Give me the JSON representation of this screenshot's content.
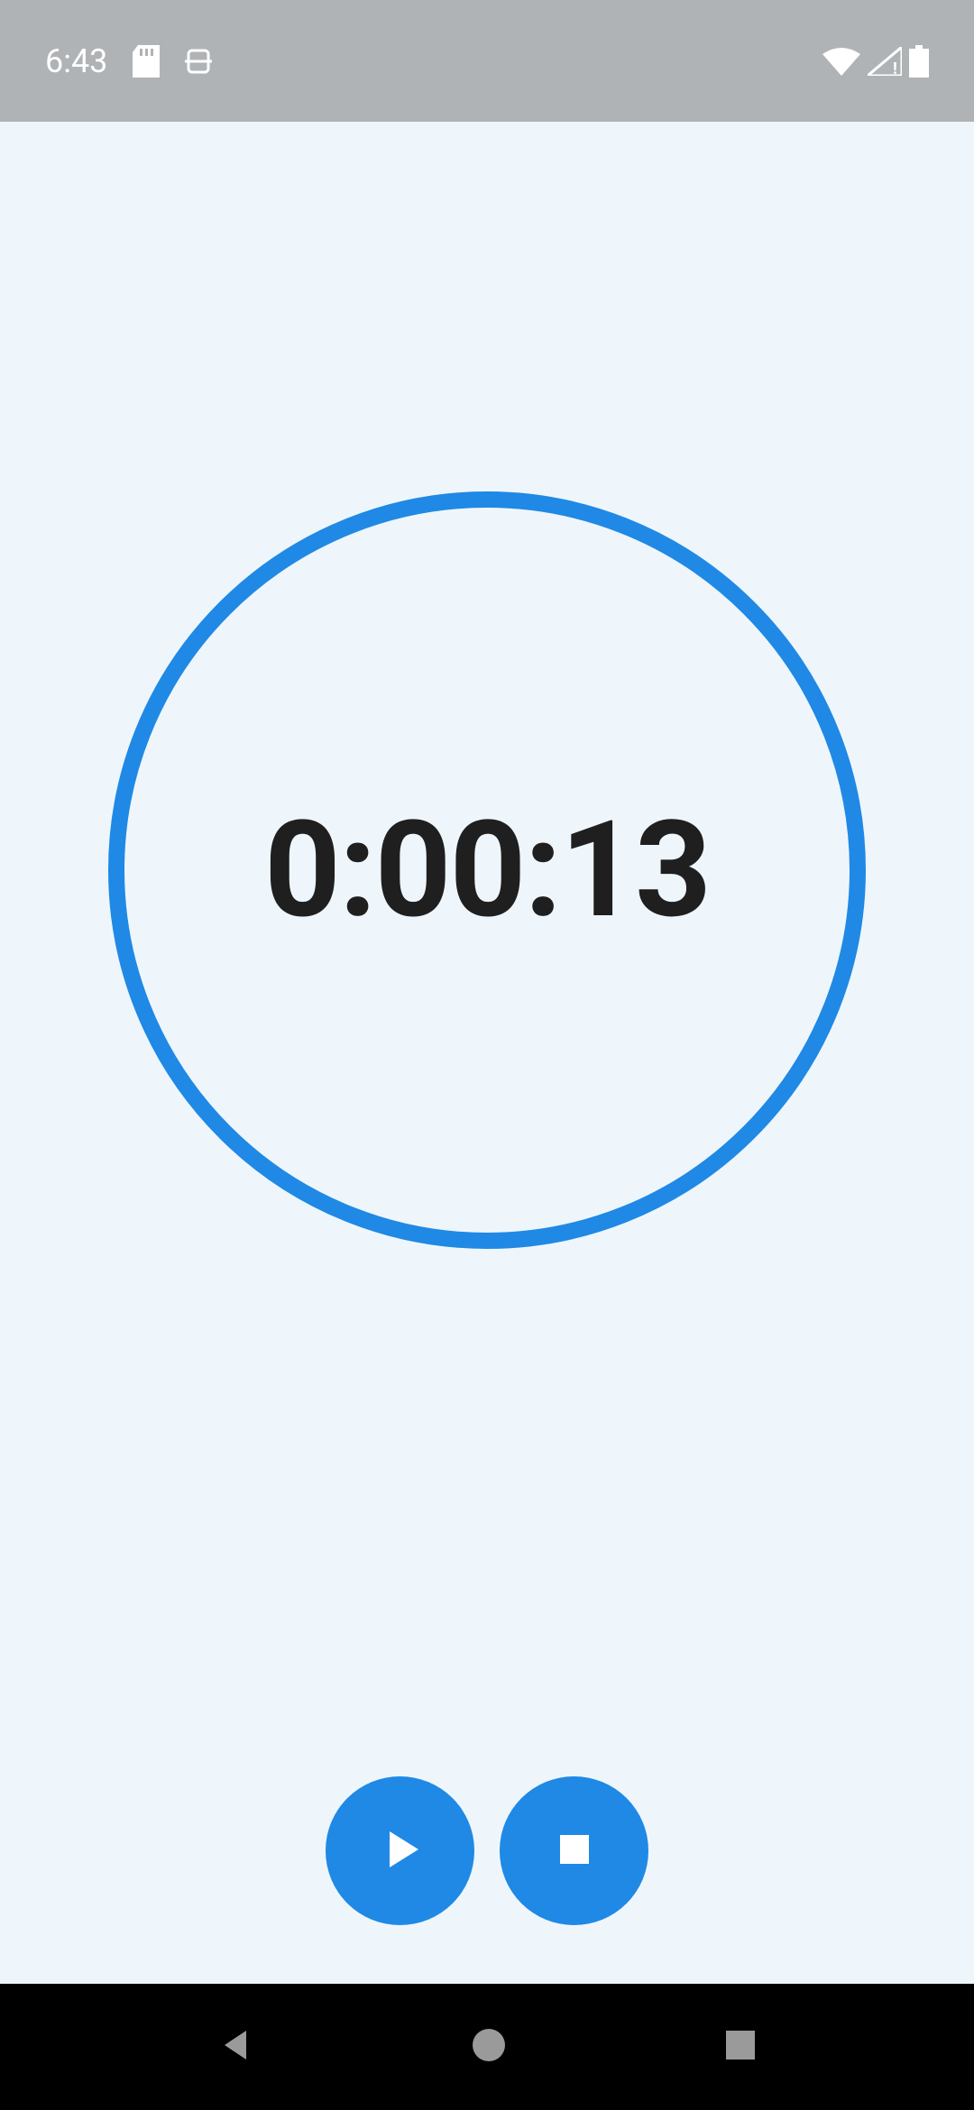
{
  "status_bar": {
    "time": "6:43",
    "icons": {
      "sd_card": "sd-card-icon",
      "app": "app-icon",
      "wifi": "wifi-icon",
      "signal": "signal-icon",
      "battery": "battery-icon"
    }
  },
  "timer": {
    "elapsed": "0:00:13"
  },
  "controls": {
    "play": "play-icon",
    "stop": "stop-icon"
  },
  "colors": {
    "accent": "#1f89e5",
    "background": "#eef6fc",
    "status_bg": "#b0b3b6"
  }
}
